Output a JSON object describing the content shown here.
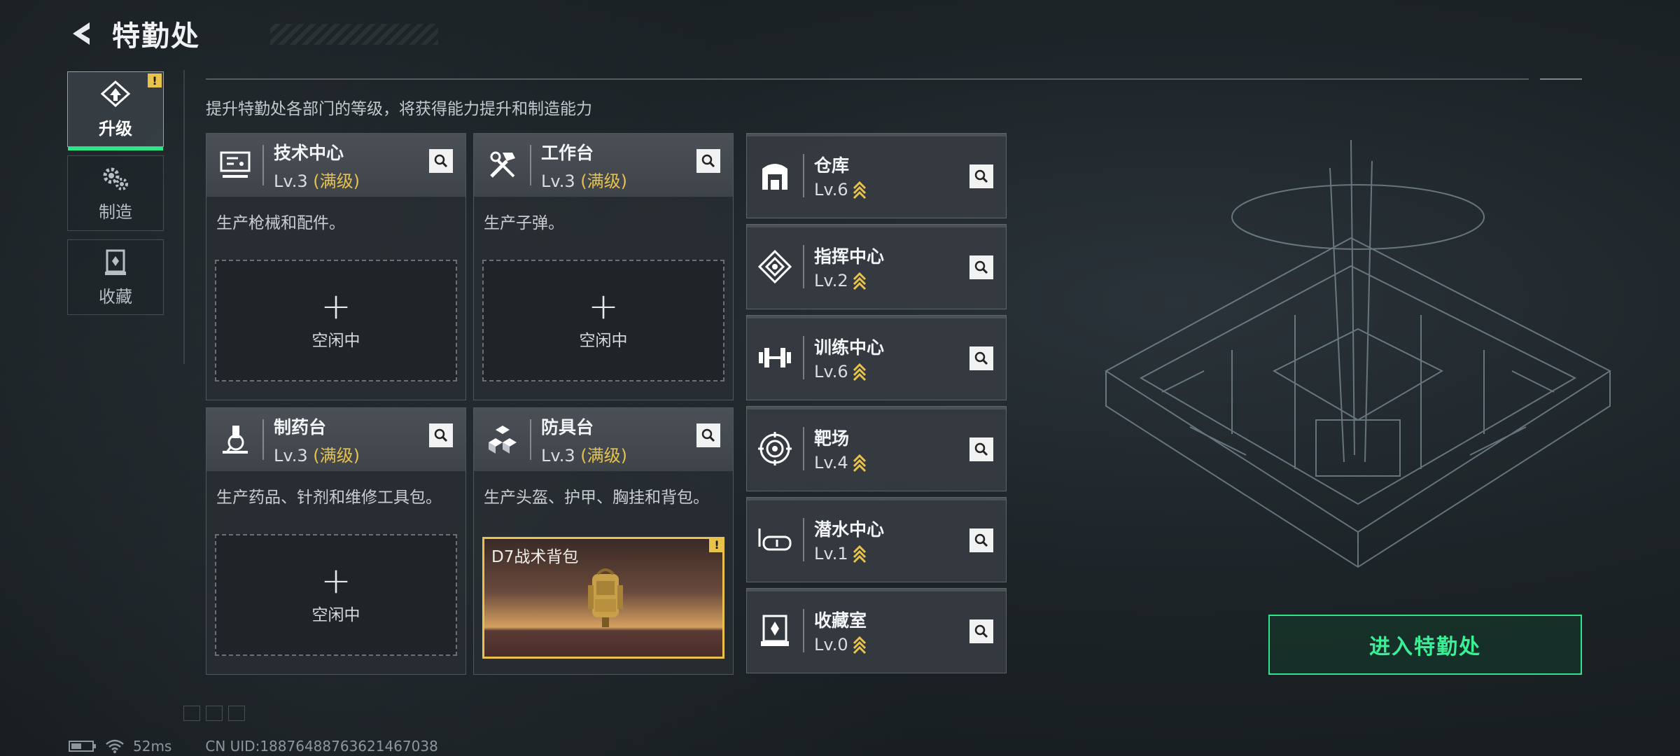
{
  "header": {
    "title": "特勤处"
  },
  "nav": {
    "items": [
      {
        "label": "升级",
        "badge": "!"
      },
      {
        "label": "制造"
      },
      {
        "label": "收藏"
      }
    ]
  },
  "description": "提升特勤处各部门的等级，将获得能力提升和制造能力",
  "cards": [
    {
      "title": "技术中心",
      "level": "Lv.3",
      "max": "(满级)",
      "text": "生产枪械和配件。",
      "slot": {
        "plus": "+",
        "label": "空闲中"
      }
    },
    {
      "title": "工作台",
      "level": "Lv.3",
      "max": "(满级)",
      "text": "生产子弹。",
      "slot": {
        "plus": "+",
        "label": "空闲中"
      }
    },
    {
      "title": "制药台",
      "level": "Lv.3",
      "max": "(满级)",
      "text": "生产药品、针剂和维修工具包。",
      "slot": {
        "plus": "+",
        "label": "空闲中"
      }
    },
    {
      "title": "防具台",
      "level": "Lv.3",
      "max": "(满级)",
      "text": "生产头盔、护甲、胸挂和背包。",
      "item": {
        "name": "D7战术背包",
        "badge": "!"
      }
    }
  ],
  "small_cards": [
    {
      "title": "仓库",
      "level": "Lv.6"
    },
    {
      "title": "指挥中心",
      "level": "Lv.2"
    },
    {
      "title": "训练中心",
      "level": "Lv.6"
    },
    {
      "title": "靶场",
      "level": "Lv.4"
    },
    {
      "title": "潜水中心",
      "level": "Lv.1"
    },
    {
      "title": "收藏室",
      "level": "Lv.0"
    }
  ],
  "enter_button": "进入特勤处",
  "footer": {
    "ping": "52ms",
    "uid": "CN UID:18876488763621467038"
  },
  "colors": {
    "accent": "#2ee58a",
    "gold": "#e8c24a"
  }
}
